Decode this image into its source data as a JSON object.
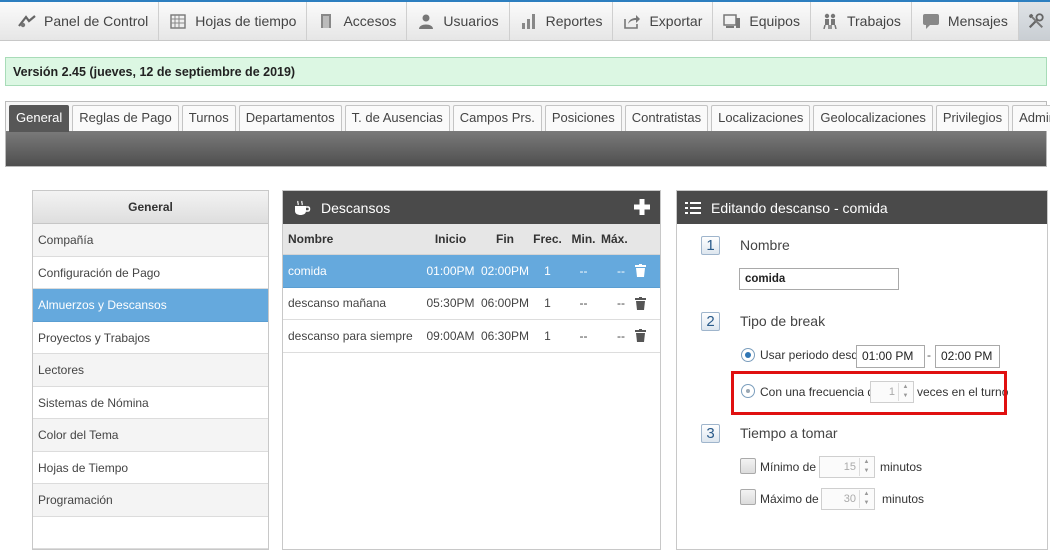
{
  "nav": {
    "items": [
      {
        "label": "Panel de Control",
        "icon": "dashboard-icon"
      },
      {
        "label": "Hojas de tiempo",
        "icon": "calendar-icon"
      },
      {
        "label": "Accesos",
        "icon": "door-icon"
      },
      {
        "label": "Usuarios",
        "icon": "user-icon"
      },
      {
        "label": "Reportes",
        "icon": "bar-chart-icon"
      },
      {
        "label": "Exportar",
        "icon": "export-icon"
      },
      {
        "label": "Equipos",
        "icon": "devices-icon"
      },
      {
        "label": "Trabajos",
        "icon": "workers-icon"
      },
      {
        "label": "Mensajes",
        "icon": "message-icon"
      }
    ],
    "active_icon": "tools-icon"
  },
  "version": "Versión 2.45 (jueves, 12 de septiembre de 2019)",
  "tabs": [
    "General",
    "Reglas de Pago",
    "Turnos",
    "Departamentos",
    "T. de Ausencias",
    "Campos Prs.",
    "Posiciones",
    "Contratistas",
    "Localizaciones",
    "Geolocalizaciones",
    "Privilegios",
    "Admins"
  ],
  "left_panel": {
    "title": "General",
    "items": [
      "Compañía",
      "Configuración de Pago",
      "Almuerzos y Descansos",
      "Proyectos y Trabajos",
      "Lectores",
      "Sistemas de Nómina",
      "Color del Tema",
      "Hojas de Tiempo",
      "Programación",
      ""
    ]
  },
  "breaks": {
    "title": "Descansos",
    "columns": {
      "name": "Nombre",
      "start": "Inicio",
      "end": "Fin",
      "freq": "Frec.",
      "min": "Min.",
      "max": "Máx."
    },
    "rows": [
      {
        "name": "comida",
        "start": "01:00PM",
        "end": "02:00PM",
        "freq": "1",
        "min": "--",
        "max": "--"
      },
      {
        "name": "descanso mañana",
        "start": "05:30PM",
        "end": "06:00PM",
        "freq": "1",
        "min": "--",
        "max": "--"
      },
      {
        "name": "descanso para siempre",
        "start": "09:00AM",
        "end": "06:30PM",
        "freq": "1",
        "min": "--",
        "max": "--"
      }
    ]
  },
  "editor": {
    "title": "Editando descanso - comida",
    "step1": {
      "num": "1",
      "label": "Nombre",
      "value": "comida"
    },
    "step2": {
      "num": "2",
      "label": "Tipo de break",
      "period_label": "Usar periodo desde",
      "from": "01:00 PM",
      "dash": "-",
      "to": "02:00 PM",
      "freq_label": "Con una frecuencia de",
      "freq_value": "1",
      "freq_suffix": "veces en el turno"
    },
    "step3": {
      "num": "3",
      "label": "Tiempo a tomar",
      "min_label": "Mínimo de",
      "min_value": "15",
      "min_unit": "minutos",
      "max_label": "Máximo de",
      "max_value": "30",
      "max_unit": "minutos"
    }
  },
  "colors": {
    "accent": "#65a9dd",
    "header_dark": "#4a4a4a",
    "highlight": "#e01010",
    "version_bg": "#dcf7e3"
  }
}
